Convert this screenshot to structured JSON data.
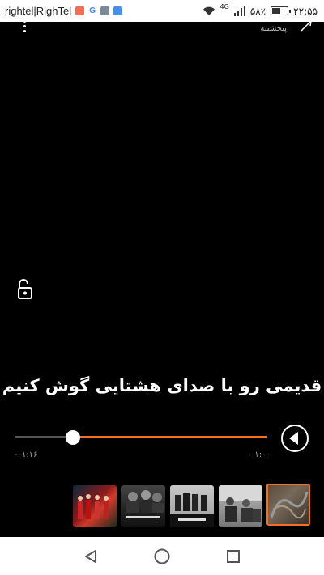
{
  "status_bar": {
    "carrier": "rightel|RighTel",
    "network_type": "4G",
    "battery_percent": "۵۸٪",
    "battery_level": 0.58,
    "time": "۲۲:۵۵"
  },
  "header": {
    "day": "پنجشنبه"
  },
  "caption": "قدیمی رو با صدای هشتایی گوش کنیم",
  "player": {
    "elapsed": "۰۱:۰۰",
    "remaining": "-۰۱:۱۶",
    "progress": 0.77,
    "accent_color": "#f36f21"
  },
  "thumbnails": [
    {
      "caption": ""
    },
    {
      "caption": ""
    },
    {
      "caption": ""
    },
    {
      "caption": ""
    },
    {
      "caption": ""
    }
  ]
}
